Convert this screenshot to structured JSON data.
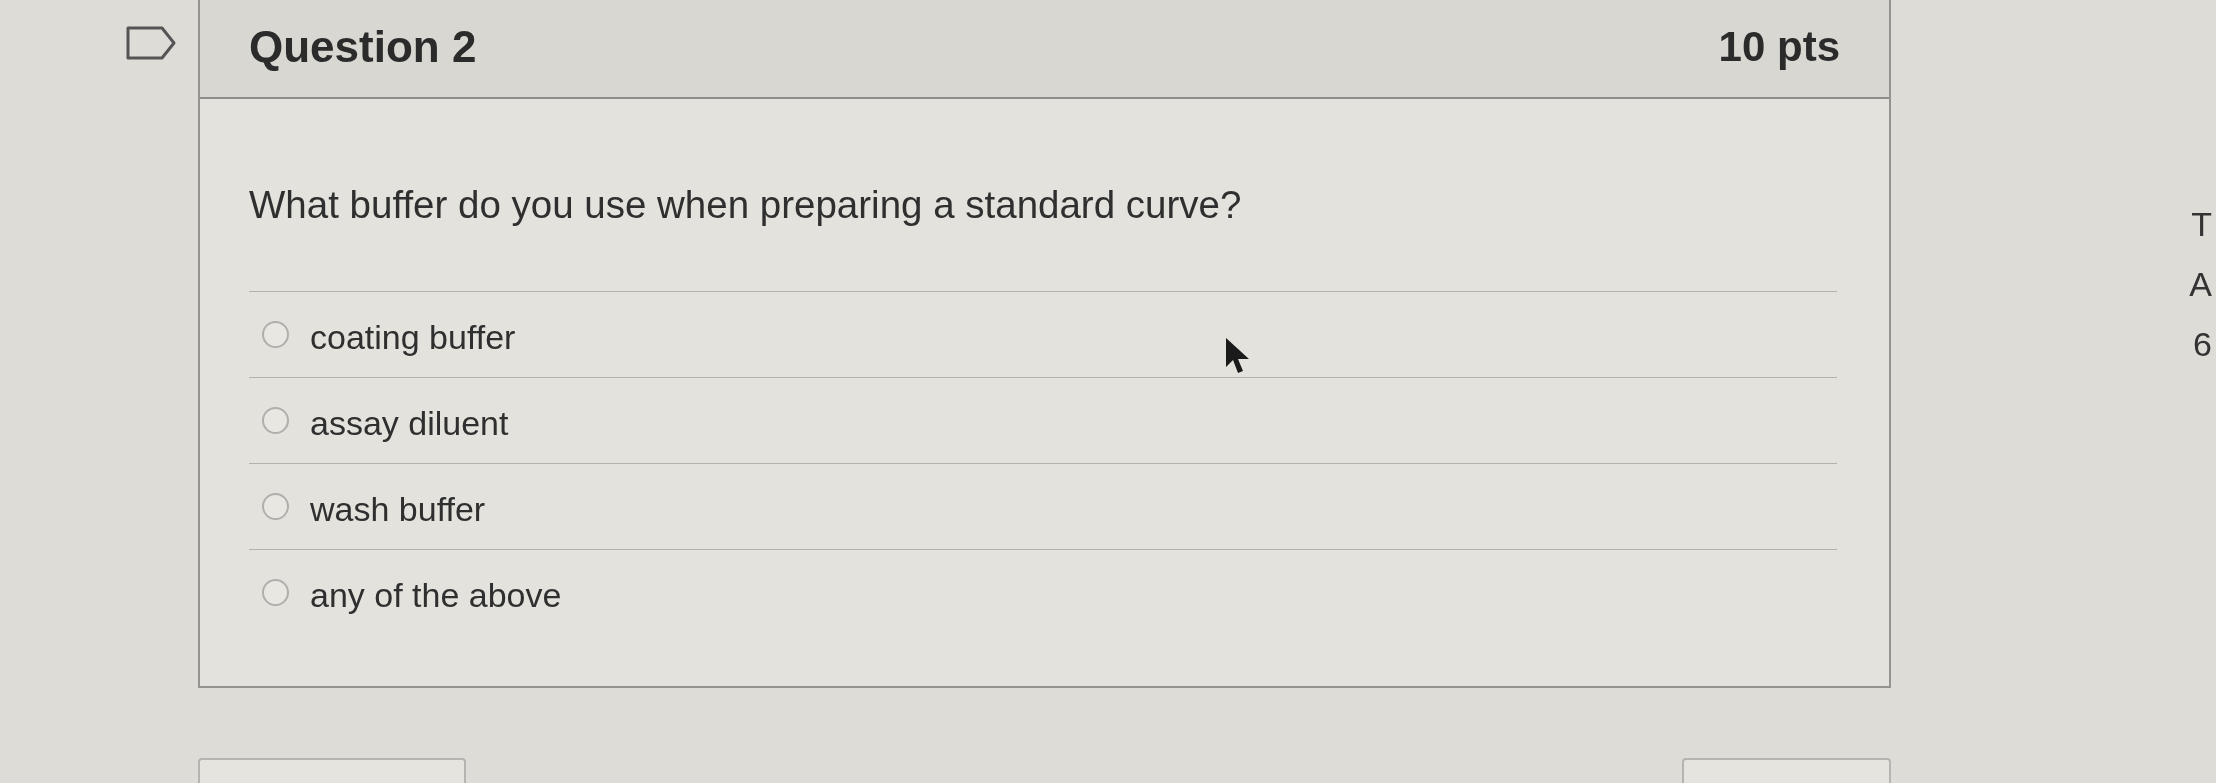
{
  "question": {
    "flagged": false,
    "title": "Question 2",
    "points": "10 pts",
    "text": "What buffer do you use when preparing a standard curve?",
    "answers": [
      {
        "label": "coating buffer",
        "selected": false
      },
      {
        "label": "assay diluent",
        "selected": false
      },
      {
        "label": "wash buffer",
        "selected": false
      },
      {
        "label": "any of the above",
        "selected": false
      }
    ]
  },
  "side_text": [
    "T",
    "A",
    "6"
  ]
}
